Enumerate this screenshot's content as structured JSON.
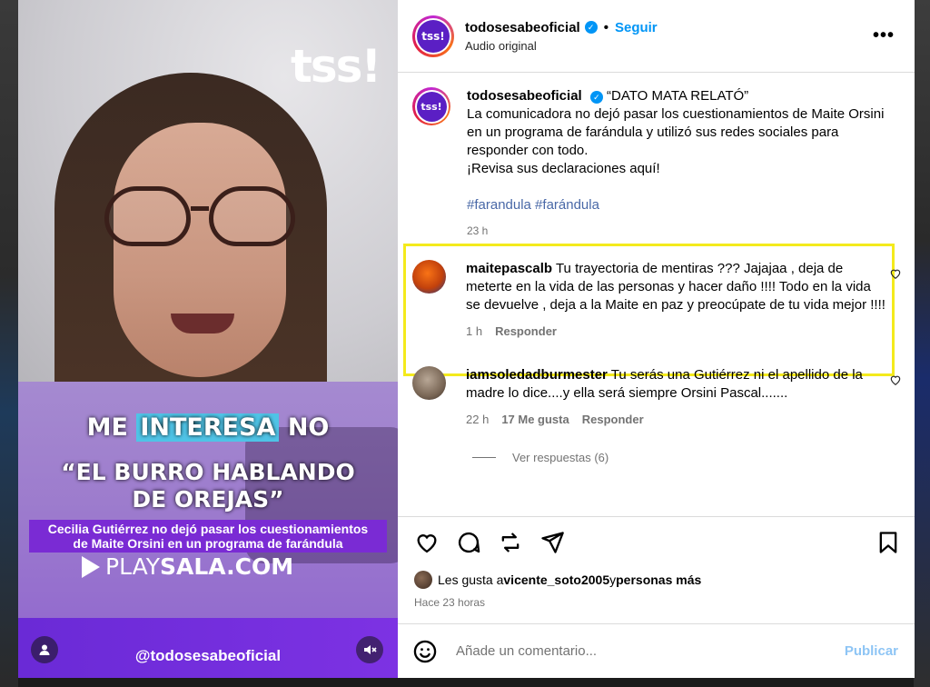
{
  "video": {
    "logo": "tss!",
    "headline_prefix": "ME ",
    "headline_highlight": "INTERESA",
    "headline_suffix": " NO",
    "quote_line1": "“EL BURRO HABLANDO",
    "quote_line2": "DE OREJAS”",
    "subtitle_line1": "Cecilia Gutiérrez no dejó pasar los cuestionamientos",
    "subtitle_line2": "de Maite Orsini en un programa de farándula",
    "brand_play": "PLAY",
    "brand_sala": "SALA.COM",
    "handle": "@todosesabeoficial"
  },
  "header": {
    "avatar_text": "tss!",
    "username": "todosesabeoficial",
    "verified_mark": "✓",
    "dot": "•",
    "follow_label": "Seguir",
    "audio_label": "Audio original",
    "more_label": "•••"
  },
  "caption": {
    "username": "todosesabeoficial",
    "title": "“DATO MATA RELATÓ”",
    "body": "La comunicadora no dejó pasar los cuestionamientos de Maite Orsini en un programa de farándula y utilizó sus redes sociales para responder con todo.",
    "cta": "¡Revisa sus declaraciones aquí!",
    "hashtags": "#farandula #farándula",
    "time": "23 h"
  },
  "comments": [
    {
      "username": "maitepascalb",
      "text": "Tu trayectoria de mentiras ??? Jajajaa , deja de meterte en la vida de las personas y hacer daño !!!! Todo en la vida se devuelve , deja a la Maite en paz y preocúpate de tu vida mejor !!!!",
      "time": "1 h",
      "reply_label": "Responder",
      "avatar_color": "#c2410c"
    },
    {
      "username": "iamsoledadburmester",
      "text": "Tu serás una Gutiérrez ni el apellido de la madre lo dice....y ella será siempre Orsini Pascal.......",
      "time": "22 h",
      "likes": "17 Me gusta",
      "reply_label": "Responder",
      "avatar_color": "#8a7a6a"
    }
  ],
  "replies": {
    "label": "Ver respuestas (6)"
  },
  "likes": {
    "prefix": "Les gusta a ",
    "user": "vicente_soto2005",
    "middle": " y ",
    "suffix": "personas más"
  },
  "posted_ago": "Hace 23 horas",
  "composer": {
    "placeholder": "Añade un comentario...",
    "publish_label": "Publicar"
  },
  "colors": {
    "accent": "#0095f6",
    "highlight_box": "#f4ea1c",
    "video_purple": "#7a2bd4"
  }
}
